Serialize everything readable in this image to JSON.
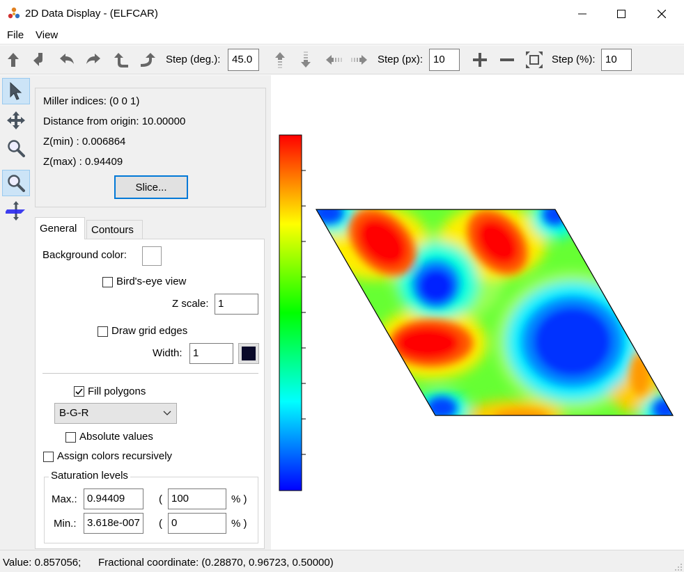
{
  "window": {
    "title": "2D Data Display - (ELFCAR)"
  },
  "menu": {
    "file": "File",
    "view": "View"
  },
  "toolbar": {
    "rot_label": "Step (deg.):",
    "rot_value": "45.0",
    "pan_label": "Step (px):",
    "pan_value": "10",
    "zoom_label": "Step (%):",
    "zoom_value": "10"
  },
  "info": {
    "miller": "Miller indices: (0 0 1)",
    "distance": "Distance from origin: 10.00000",
    "zmin": "Z(min) : 0.006864",
    "zmax": "Z(max) : 0.94409",
    "slice_button": "Slice..."
  },
  "tabs": [
    {
      "label": "General"
    },
    {
      "label": "Contours"
    }
  ],
  "general": {
    "bg_label": "Background color:",
    "birdseye_label": "Bird's-eye view",
    "zscale_label": "Z scale:",
    "zscale_value": "1",
    "grid_label": "Draw grid edges",
    "width_label": "Width:",
    "width_value": "1",
    "grid_color": "#0a0a2a",
    "fill_label": "Fill polygons",
    "colormap": "B-G-R",
    "absolute_label": "Absolute values",
    "recursive_label": "Assign colors recursively",
    "saturation_title": "Saturation levels",
    "max_label": "Max.:",
    "max_value": "0.94409",
    "max_pct": "100",
    "min_label": "Min.:",
    "min_value": "3.618e-007",
    "min_pct": "0",
    "paren_open": "(",
    "pct_close": "% )"
  },
  "status": {
    "value": "Value: 0.857056;",
    "coord": "Fractional coordinate: (0.28870, 0.96723, 0.50000)"
  }
}
